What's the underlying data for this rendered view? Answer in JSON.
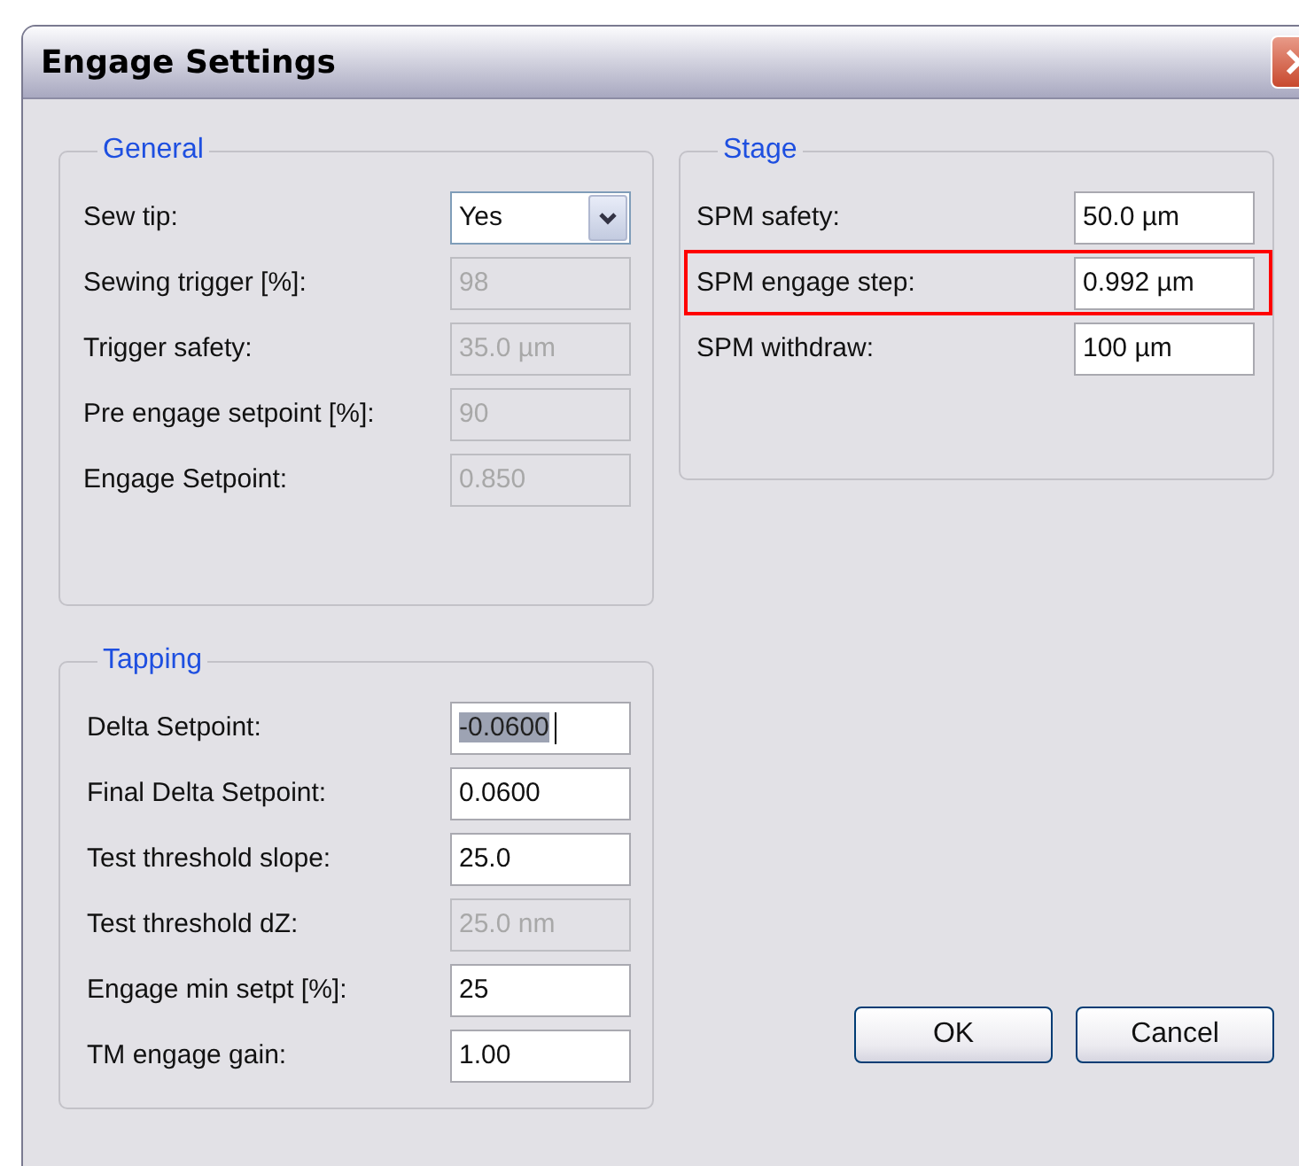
{
  "window": {
    "title": "Engage Settings"
  },
  "general": {
    "title": "General",
    "fields": [
      {
        "label": "Sew tip:",
        "value": "Yes",
        "kind": "dropdown"
      },
      {
        "label": "Sewing trigger [%]:",
        "value": "98",
        "kind": "text",
        "disabled": true
      },
      {
        "label": "Trigger safety:",
        "value": "35.0 µm",
        "kind": "text",
        "disabled": true
      },
      {
        "label": "Pre engage setpoint [%]:",
        "value": "90",
        "kind": "text",
        "disabled": true
      },
      {
        "label": "Engage Setpoint:",
        "value": "0.850",
        "kind": "text",
        "disabled": true
      }
    ]
  },
  "tapping": {
    "title": "Tapping",
    "fields": [
      {
        "label": "Delta Setpoint:",
        "value": "-0.0600",
        "kind": "text",
        "disabled": false,
        "focused": true
      },
      {
        "label": "Final Delta Setpoint:",
        "value": "0.0600",
        "kind": "text",
        "disabled": false,
        "focused": false
      },
      {
        "label": "Test threshold slope:",
        "value": "25.0",
        "kind": "text",
        "disabled": false,
        "focused": false
      },
      {
        "label": "Test threshold dZ:",
        "value": "25.0 nm",
        "kind": "text",
        "disabled": true,
        "focused": false
      },
      {
        "label": "Engage min setpt [%]:",
        "value": "25",
        "kind": "text",
        "disabled": false,
        "focused": false
      },
      {
        "label": "TM engage gain:",
        "value": "1.00",
        "kind": "text",
        "disabled": false,
        "focused": false
      }
    ]
  },
  "stage": {
    "title": "Stage",
    "fields": [
      {
        "label": "SPM safety:",
        "value": "50.0 µm",
        "kind": "text",
        "disabled": false,
        "highlighted": false
      },
      {
        "label": "SPM engage step:",
        "value": "0.992 µm",
        "kind": "text",
        "disabled": false,
        "highlighted": true
      },
      {
        "label": "SPM withdraw:",
        "value": "100 µm",
        "kind": "text",
        "disabled": false,
        "highlighted": false
      }
    ]
  },
  "buttons": [
    "OK",
    "Cancel"
  ]
}
